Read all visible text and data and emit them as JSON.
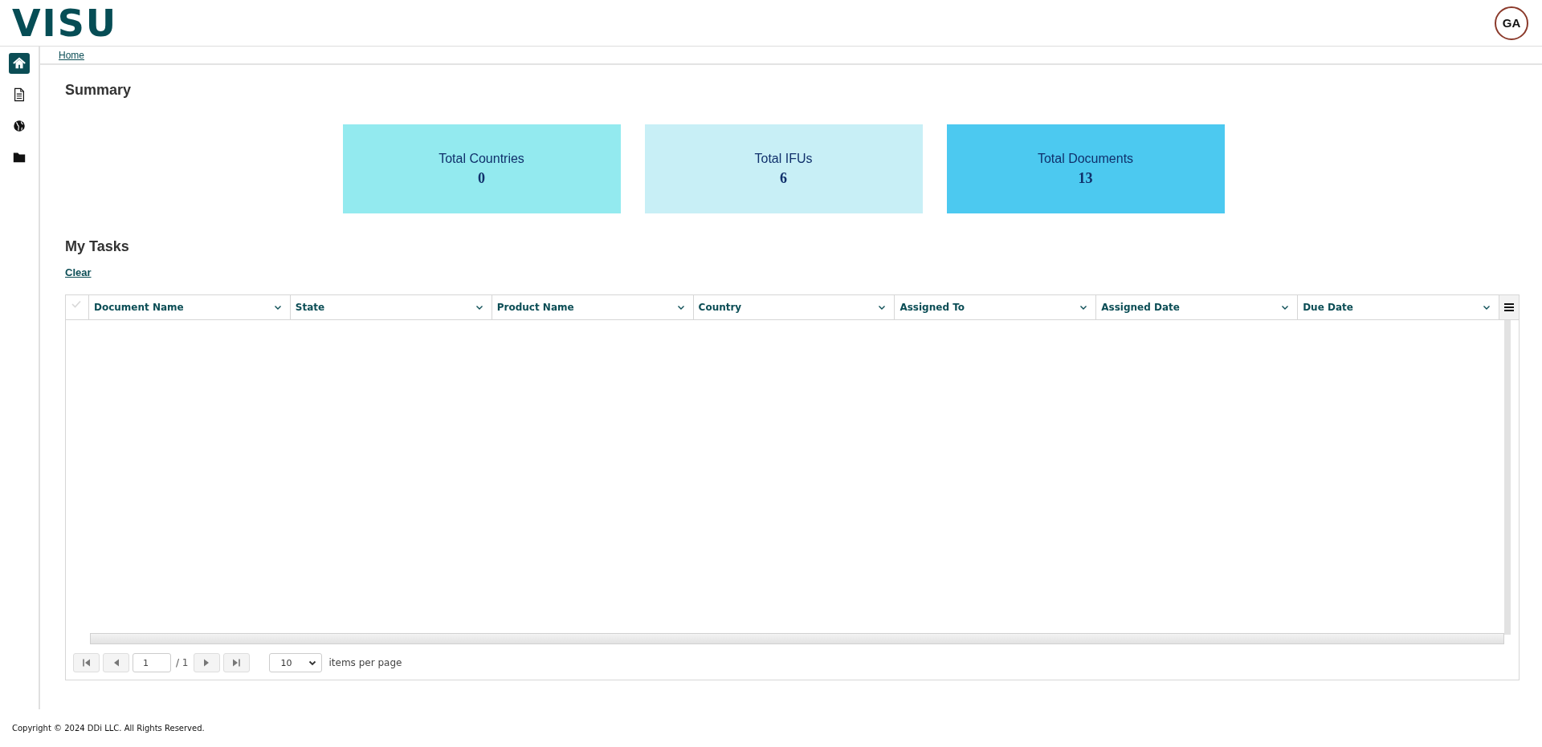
{
  "header": {
    "logo": "VISU",
    "avatar": "GA"
  },
  "sidebar": {
    "items": [
      {
        "kind": "home",
        "selected": true
      },
      {
        "kind": "document",
        "selected": false
      },
      {
        "kind": "globe",
        "selected": false
      },
      {
        "kind": "folder",
        "selected": false
      }
    ]
  },
  "breadcrumb": [
    "Home"
  ],
  "summary": {
    "title": "Summary",
    "cards": [
      {
        "label": "Total Countries",
        "value": "0",
        "color": "#93eaef"
      },
      {
        "label": "Total IFUs",
        "value": "6",
        "color": "#c8eff6"
      },
      {
        "label": "Total Documents",
        "value": "13",
        "color": "#4cc9f0"
      }
    ]
  },
  "tasks": {
    "title": "My Tasks",
    "clear_link": "Clear",
    "select_all": {
      "checked": false
    },
    "columns": [
      "Document Name",
      "State",
      "Product Name",
      "Country",
      "Assigned To",
      "Assigned Date",
      "Due Date"
    ],
    "pager": {
      "page": "1",
      "total": "/ 1",
      "page_size": "10",
      "page_size_label": "items per page"
    }
  },
  "footer": "Copyright © 2024 DDi LLC. All Rights Reserved."
}
